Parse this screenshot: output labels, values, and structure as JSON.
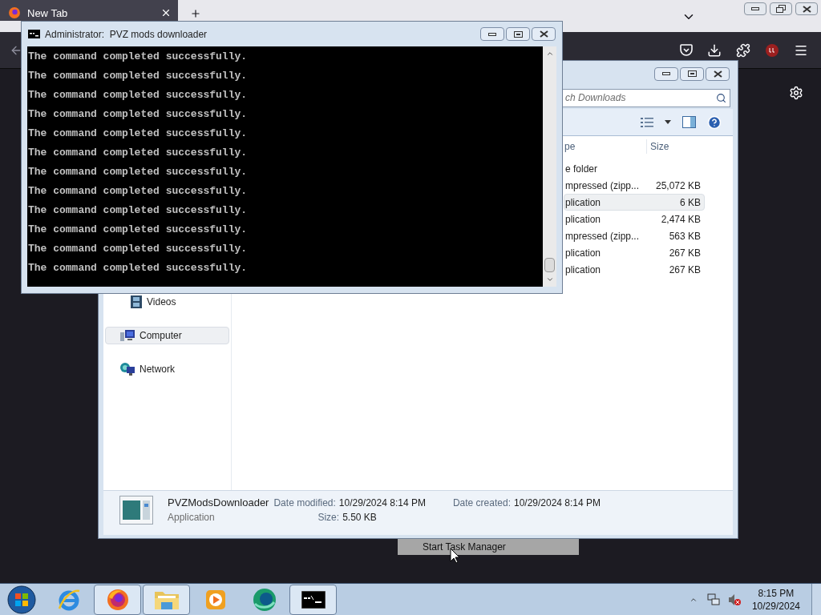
{
  "browser": {
    "tabs": [
      {
        "title": "New Tab",
        "selected": true
      }
    ]
  },
  "cmd_window": {
    "title": "Administrator:  PVZ mods downloader",
    "lines": [
      "The command completed successfully.",
      "The command completed successfully.",
      "The command completed successfully.",
      "The command completed successfully.",
      "The command completed successfully.",
      "The command completed successfully.",
      "The command completed successfully.",
      "The command completed successfully.",
      "The command completed successfully.",
      "The command completed successfully.",
      "The command completed successfully.",
      "The command completed successfully."
    ]
  },
  "explorer": {
    "search": {
      "placeholder": "ch Downloads"
    },
    "columns": [
      "pe",
      "Size"
    ],
    "rows": [
      {
        "type": "e folder",
        "selected": false
      },
      {
        "type": "mpressed (zipp...",
        "size": "25,072 KB",
        "selected": false
      },
      {
        "type": "plication",
        "size": "6 KB",
        "selected": true
      },
      {
        "type": "plication",
        "size": "2,474 KB",
        "selected": false
      },
      {
        "type": "mpressed (zipp...",
        "size": "563 KB",
        "selected": false
      },
      {
        "type": "plication",
        "size": "267 KB",
        "selected": false
      },
      {
        "type": "plication",
        "size": "267 KB",
        "selected": false
      }
    ],
    "nav": [
      {
        "label": "Videos",
        "kind": "videos",
        "selected": false
      },
      {
        "label": "Computer",
        "kind": "computer",
        "selected": true
      },
      {
        "label": "Network",
        "kind": "network",
        "selected": false
      }
    ],
    "details": {
      "name": "PVZModsDownloader",
      "type": "Application",
      "fields": [
        {
          "label": "Date modified:",
          "value": "10/29/2024 8:14 PM"
        },
        {
          "label": "Size:",
          "value": "5.50 KB"
        },
        {
          "label": "Date created:",
          "value": "10/29/2024 8:14 PM"
        }
      ]
    }
  },
  "context_menu": {
    "items": [
      {
        "label": "Start Task Manager",
        "selected": true
      }
    ]
  },
  "taskbar": {
    "apps": [
      {
        "kind": "ie",
        "open": false
      },
      {
        "kind": "firefox",
        "open": true
      },
      {
        "kind": "folder",
        "open": true
      },
      {
        "kind": "media",
        "open": false
      },
      {
        "kind": "green",
        "open": false
      },
      {
        "kind": "cmd",
        "open": true
      }
    ],
    "time": "8:15 PM",
    "date": "10/29/2024"
  }
}
